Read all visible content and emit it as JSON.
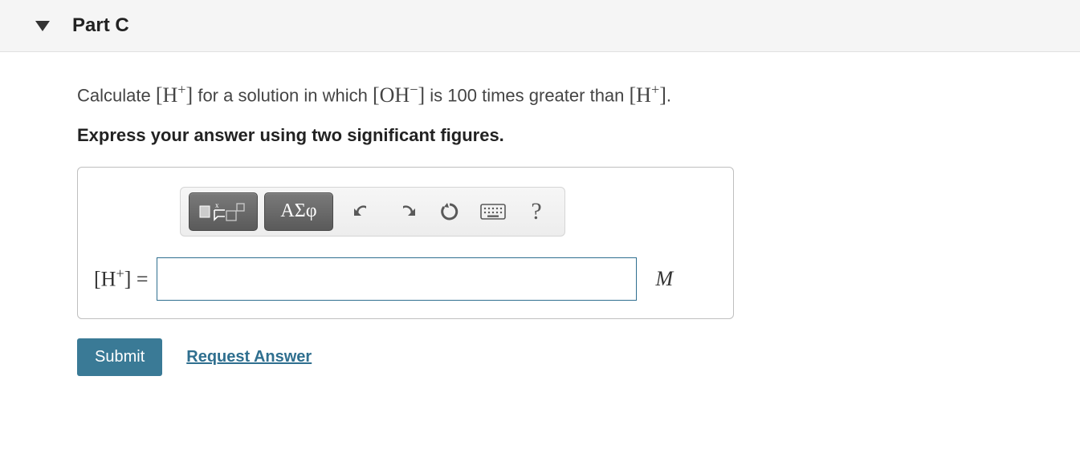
{
  "part": {
    "label": "Part C"
  },
  "question": {
    "pre": "Calculate ",
    "mid1": " for a solution in which ",
    "mid2": " is 100 times greater than ",
    "end": "."
  },
  "species": {
    "h_plus_open": "[H",
    "h_plus_sup": "+",
    "h_plus_close": "]",
    "oh_open": "[OH",
    "oh_sup": "−",
    "oh_close": "]"
  },
  "instruction": "Express your answer using two significant figures.",
  "toolbar": {
    "greek_label": "ΑΣφ"
  },
  "answer": {
    "label_open": "[H",
    "label_sup": "+",
    "label_close": "] =",
    "value": "",
    "unit": "M"
  },
  "buttons": {
    "submit": "Submit",
    "request": "Request Answer"
  },
  "help_label": "?"
}
